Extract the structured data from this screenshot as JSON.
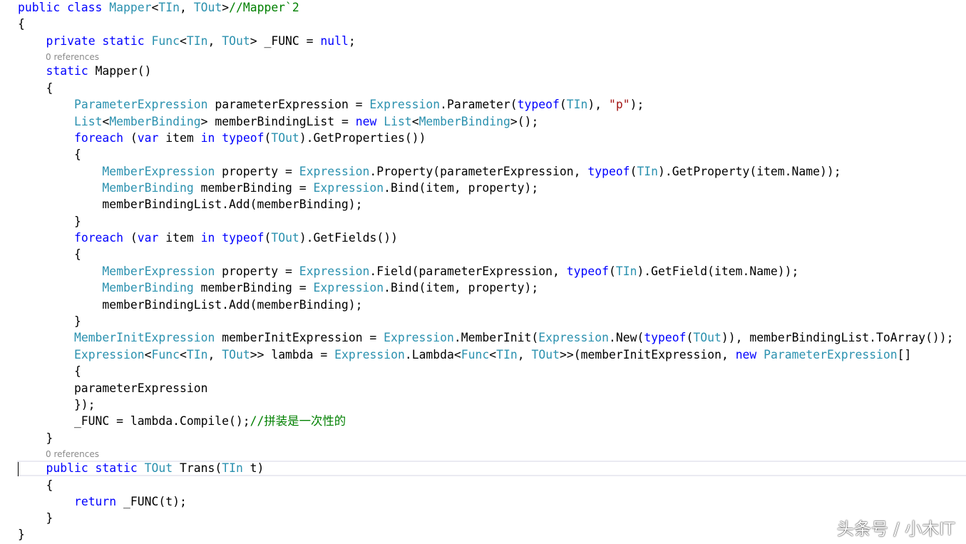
{
  "colors": {
    "keyword": "#0000ff",
    "type": "#2b91af",
    "string": "#a31515",
    "comment": "#008000",
    "plain": "#000000",
    "codelens": "#8a8a8a",
    "background": "#ffffff"
  },
  "code_lines": [
    [
      {
        "t": "public class ",
        "k": "kw"
      },
      {
        "t": "Mapper",
        "k": "ty"
      },
      {
        "t": "<",
        "k": "pl"
      },
      {
        "t": "TIn",
        "k": "ty"
      },
      {
        "t": ", ",
        "k": "pl"
      },
      {
        "t": "TOut",
        "k": "ty"
      },
      {
        "t": ">",
        "k": "pl"
      },
      {
        "t": "//Mapper`2",
        "k": "cm"
      }
    ],
    [
      {
        "t": "{",
        "k": "pl"
      }
    ],
    [
      {
        "t": "    ",
        "k": "pl"
      },
      {
        "t": "private static ",
        "k": "kw"
      },
      {
        "t": "Func",
        "k": "ty"
      },
      {
        "t": "<",
        "k": "pl"
      },
      {
        "t": "TIn",
        "k": "ty"
      },
      {
        "t": ", ",
        "k": "pl"
      },
      {
        "t": "TOut",
        "k": "ty"
      },
      {
        "t": "> _FUNC = ",
        "k": "pl"
      },
      {
        "t": "null",
        "k": "kw"
      },
      {
        "t": ";",
        "k": "pl"
      }
    ],
    [
      {
        "t": "    ",
        "k": "pl"
      },
      {
        "t": "static ",
        "k": "kw"
      },
      {
        "t": "Mapper()",
        "k": "pl"
      }
    ],
    [
      {
        "t": "    {",
        "k": "pl"
      }
    ],
    [
      {
        "t": "        ",
        "k": "pl"
      },
      {
        "t": "ParameterExpression",
        "k": "ty"
      },
      {
        "t": " parameterExpression = ",
        "k": "pl"
      },
      {
        "t": "Expression",
        "k": "ty"
      },
      {
        "t": ".Parameter(",
        "k": "pl"
      },
      {
        "t": "typeof",
        "k": "kw"
      },
      {
        "t": "(",
        "k": "pl"
      },
      {
        "t": "TIn",
        "k": "ty"
      },
      {
        "t": "), ",
        "k": "pl"
      },
      {
        "t": "\"p\"",
        "k": "str"
      },
      {
        "t": ");",
        "k": "pl"
      }
    ],
    [
      {
        "t": "        ",
        "k": "pl"
      },
      {
        "t": "List",
        "k": "ty"
      },
      {
        "t": "<",
        "k": "pl"
      },
      {
        "t": "MemberBinding",
        "k": "ty"
      },
      {
        "t": "> memberBindingList = ",
        "k": "pl"
      },
      {
        "t": "new ",
        "k": "kw"
      },
      {
        "t": "List",
        "k": "ty"
      },
      {
        "t": "<",
        "k": "pl"
      },
      {
        "t": "MemberBinding",
        "k": "ty"
      },
      {
        "t": ">();",
        "k": "pl"
      }
    ],
    [
      {
        "t": "        ",
        "k": "pl"
      },
      {
        "t": "foreach",
        "k": "kw"
      },
      {
        "t": " (",
        "k": "pl"
      },
      {
        "t": "var",
        "k": "kw"
      },
      {
        "t": " item ",
        "k": "pl"
      },
      {
        "t": "in",
        "k": "kw"
      },
      {
        "t": " ",
        "k": "pl"
      },
      {
        "t": "typeof",
        "k": "kw"
      },
      {
        "t": "(",
        "k": "pl"
      },
      {
        "t": "TOut",
        "k": "ty"
      },
      {
        "t": ").GetProperties())",
        "k": "pl"
      }
    ],
    [
      {
        "t": "        {",
        "k": "pl"
      }
    ],
    [
      {
        "t": "            ",
        "k": "pl"
      },
      {
        "t": "MemberExpression",
        "k": "ty"
      },
      {
        "t": " property = ",
        "k": "pl"
      },
      {
        "t": "Expression",
        "k": "ty"
      },
      {
        "t": ".Property(parameterExpression, ",
        "k": "pl"
      },
      {
        "t": "typeof",
        "k": "kw"
      },
      {
        "t": "(",
        "k": "pl"
      },
      {
        "t": "TIn",
        "k": "ty"
      },
      {
        "t": ").GetProperty(item.Name));",
        "k": "pl"
      }
    ],
    [
      {
        "t": "            ",
        "k": "pl"
      },
      {
        "t": "MemberBinding",
        "k": "ty"
      },
      {
        "t": " memberBinding = ",
        "k": "pl"
      },
      {
        "t": "Expression",
        "k": "ty"
      },
      {
        "t": ".Bind(item, property);",
        "k": "pl"
      }
    ],
    [
      {
        "t": "            memberBindingList.Add(memberBinding);",
        "k": "pl"
      }
    ],
    [
      {
        "t": "        }",
        "k": "pl"
      }
    ],
    [
      {
        "t": "        ",
        "k": "pl"
      },
      {
        "t": "foreach",
        "k": "kw"
      },
      {
        "t": " (",
        "k": "pl"
      },
      {
        "t": "var",
        "k": "kw"
      },
      {
        "t": " item ",
        "k": "pl"
      },
      {
        "t": "in",
        "k": "kw"
      },
      {
        "t": " ",
        "k": "pl"
      },
      {
        "t": "typeof",
        "k": "kw"
      },
      {
        "t": "(",
        "k": "pl"
      },
      {
        "t": "TOut",
        "k": "ty"
      },
      {
        "t": ").GetFields())",
        "k": "pl"
      }
    ],
    [
      {
        "t": "        {",
        "k": "pl"
      }
    ],
    [
      {
        "t": "            ",
        "k": "pl"
      },
      {
        "t": "MemberExpression",
        "k": "ty"
      },
      {
        "t": " property = ",
        "k": "pl"
      },
      {
        "t": "Expression",
        "k": "ty"
      },
      {
        "t": ".Field(parameterExpression, ",
        "k": "pl"
      },
      {
        "t": "typeof",
        "k": "kw"
      },
      {
        "t": "(",
        "k": "pl"
      },
      {
        "t": "TIn",
        "k": "ty"
      },
      {
        "t": ").GetField(item.Name));",
        "k": "pl"
      }
    ],
    [
      {
        "t": "            ",
        "k": "pl"
      },
      {
        "t": "MemberBinding",
        "k": "ty"
      },
      {
        "t": " memberBinding = ",
        "k": "pl"
      },
      {
        "t": "Expression",
        "k": "ty"
      },
      {
        "t": ".Bind(item, property);",
        "k": "pl"
      }
    ],
    [
      {
        "t": "            memberBindingList.Add(memberBinding);",
        "k": "pl"
      }
    ],
    [
      {
        "t": "        }",
        "k": "pl"
      }
    ],
    [
      {
        "t": "        ",
        "k": "pl"
      },
      {
        "t": "MemberInitExpression",
        "k": "ty"
      },
      {
        "t": " memberInitExpression = ",
        "k": "pl"
      },
      {
        "t": "Expression",
        "k": "ty"
      },
      {
        "t": ".MemberInit(",
        "k": "pl"
      },
      {
        "t": "Expression",
        "k": "ty"
      },
      {
        "t": ".New(",
        "k": "pl"
      },
      {
        "t": "typeof",
        "k": "kw"
      },
      {
        "t": "(",
        "k": "pl"
      },
      {
        "t": "TOut",
        "k": "ty"
      },
      {
        "t": ")), memberBindingList.ToArray());",
        "k": "pl"
      }
    ],
    [
      {
        "t": "        ",
        "k": "pl"
      },
      {
        "t": "Expression",
        "k": "ty"
      },
      {
        "t": "<",
        "k": "pl"
      },
      {
        "t": "Func",
        "k": "ty"
      },
      {
        "t": "<",
        "k": "pl"
      },
      {
        "t": "TIn",
        "k": "ty"
      },
      {
        "t": ", ",
        "k": "pl"
      },
      {
        "t": "TOut",
        "k": "ty"
      },
      {
        "t": ">> lambda = ",
        "k": "pl"
      },
      {
        "t": "Expression",
        "k": "ty"
      },
      {
        "t": ".Lambda<",
        "k": "pl"
      },
      {
        "t": "Func",
        "k": "ty"
      },
      {
        "t": "<",
        "k": "pl"
      },
      {
        "t": "TIn",
        "k": "ty"
      },
      {
        "t": ", ",
        "k": "pl"
      },
      {
        "t": "TOut",
        "k": "ty"
      },
      {
        "t": ">>(memberInitExpression, ",
        "k": "pl"
      },
      {
        "t": "new ",
        "k": "kw"
      },
      {
        "t": "ParameterExpression",
        "k": "ty"
      },
      {
        "t": "[]",
        "k": "pl"
      }
    ],
    [
      {
        "t": "        {",
        "k": "pl"
      }
    ],
    [
      {
        "t": "        parameterExpression",
        "k": "pl"
      }
    ],
    [
      {
        "t": "        });",
        "k": "pl"
      }
    ],
    [
      {
        "t": "        _FUNC = lambda.Compile();",
        "k": "pl"
      },
      {
        "t": "//拼装是一次性的",
        "k": "cm"
      }
    ],
    [
      {
        "t": "    }",
        "k": "pl"
      }
    ],
    [
      {
        "t": "    ",
        "k": "pl"
      },
      {
        "t": "public static ",
        "k": "kw"
      },
      {
        "t": "TOut",
        "k": "ty"
      },
      {
        "t": " Trans(",
        "k": "pl"
      },
      {
        "t": "TIn",
        "k": "ty"
      },
      {
        "t": " t)",
        "k": "pl"
      }
    ],
    [
      {
        "t": "    {",
        "k": "pl"
      }
    ],
    [
      {
        "t": "        ",
        "k": "pl"
      },
      {
        "t": "return",
        "k": "kw"
      },
      {
        "t": " _FUNC(t);",
        "k": "pl"
      }
    ],
    [
      {
        "t": "    }",
        "k": "pl"
      }
    ],
    [
      {
        "t": "}",
        "k": "pl"
      }
    ]
  ],
  "codelens": {
    "mapper_ctor_refs": "0 references",
    "trans_refs": "0 references"
  },
  "watermark": {
    "text": "头条号 / 小木IT"
  }
}
